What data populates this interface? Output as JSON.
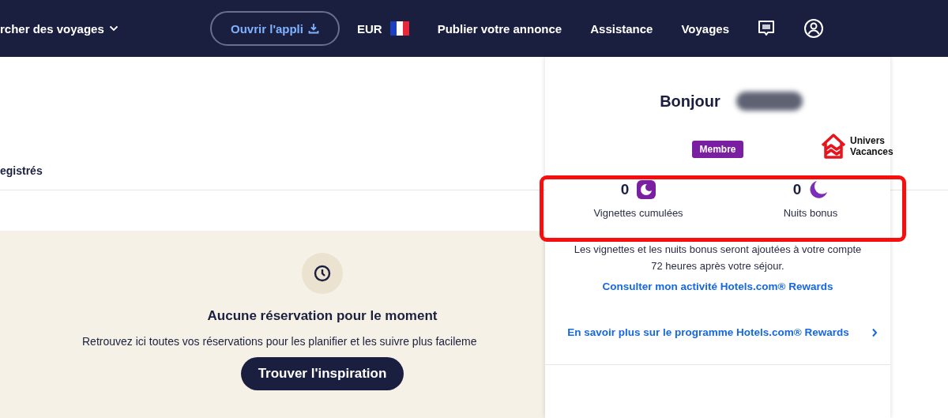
{
  "nav": {
    "trips_menu": "rcher des voyages",
    "open_app": "Ouvrir l'appli",
    "currency": "EUR",
    "links": [
      "Publier votre annonce",
      "Assistance",
      "Voyages"
    ]
  },
  "main": {
    "tab_label": "egistrés",
    "empty_title": "Aucune réservation pour le moment",
    "empty_text": "Retrouvez ici toutes vos réservations pour les planifier et les suivre plus facileme",
    "button": "Trouver l'inspiration"
  },
  "account_panel": {
    "greeting": "Bonjour",
    "badge": "Membre",
    "logo": [
      "Univers",
      "Vacances"
    ],
    "stats": [
      {
        "kind": "stamp",
        "value": "0",
        "label": "Vignettes cumulées"
      },
      {
        "kind": "moon",
        "value": "0",
        "label": "Nuits bonus"
      }
    ],
    "note": "Les vignettes et les nuits bonus seront ajoutées à votre compte 72 heures après votre séjour.",
    "activity_link": "Consulter mon activité Hotels.com® Rewards",
    "program_link": "En savoir plus sur le programme Hotels.com® Rewards"
  }
}
